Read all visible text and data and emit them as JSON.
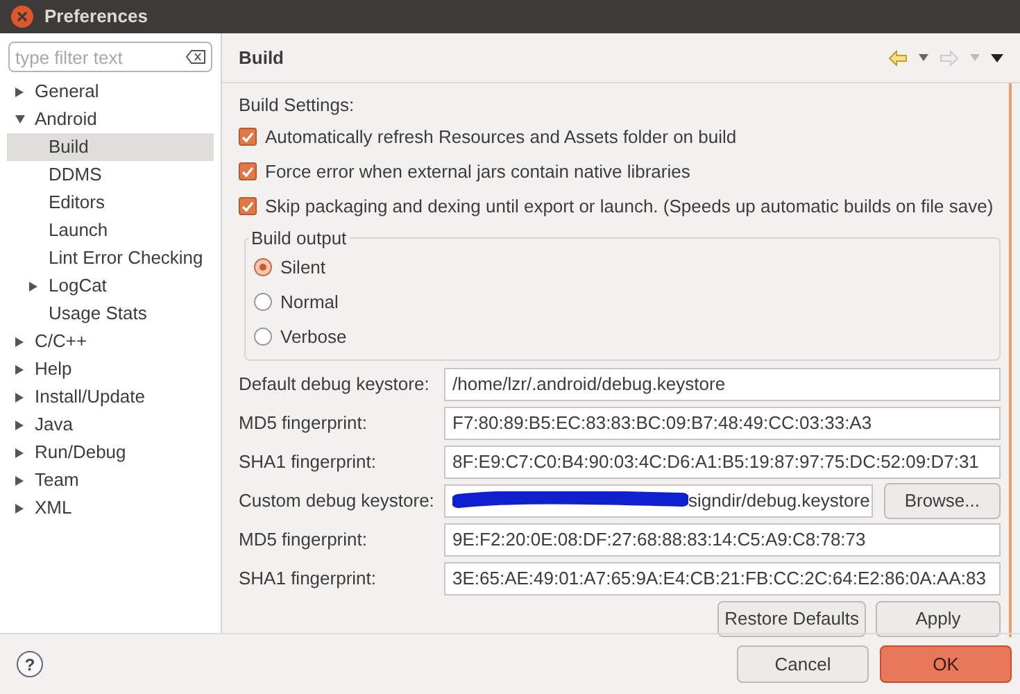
{
  "window": {
    "title": "Preferences"
  },
  "filter": {
    "placeholder": "type filter text"
  },
  "tree": [
    {
      "label": "General",
      "expanded": false,
      "selected": false
    },
    {
      "label": "Android",
      "expanded": true,
      "selected": false,
      "children": [
        {
          "label": "Build",
          "selected": true
        },
        {
          "label": "DDMS",
          "selected": false
        },
        {
          "label": "Editors",
          "selected": false
        },
        {
          "label": "Launch",
          "selected": false
        },
        {
          "label": "Lint Error Checking",
          "selected": false
        },
        {
          "label": "LogCat",
          "expanded": false,
          "selected": false
        },
        {
          "label": "Usage Stats",
          "selected": false
        }
      ]
    },
    {
      "label": "C/C++",
      "expanded": false,
      "selected": false
    },
    {
      "label": "Help",
      "expanded": false,
      "selected": false
    },
    {
      "label": "Install/Update",
      "expanded": false,
      "selected": false
    },
    {
      "label": "Java",
      "expanded": false,
      "selected": false
    },
    {
      "label": "Run/Debug",
      "expanded": false,
      "selected": false
    },
    {
      "label": "Team",
      "expanded": false,
      "selected": false
    },
    {
      "label": "XML",
      "expanded": false,
      "selected": false
    }
  ],
  "page": {
    "title": "Build",
    "settings_label": "Build Settings:",
    "checkboxes": [
      {
        "label": "Automatically refresh Resources and Assets folder on build",
        "checked": true
      },
      {
        "label": "Force error when external jars contain native libraries",
        "checked": true
      },
      {
        "label": "Skip packaging and dexing until export or launch. (Speeds up automatic builds on file save)",
        "checked": true
      }
    ],
    "build_output": {
      "title": "Build output",
      "options": [
        {
          "label": "Silent",
          "selected": true
        },
        {
          "label": "Normal",
          "selected": false
        },
        {
          "label": "Verbose",
          "selected": false
        }
      ]
    },
    "fields": [
      {
        "label": "Default debug keystore:",
        "value": "/home/lzr/.android/debug.keystore"
      },
      {
        "label": "MD5 fingerprint:",
        "value": "F7:80:89:B5:EC:83:83:BC:09:B7:48:49:CC:03:33:A3"
      },
      {
        "label": "SHA1 fingerprint:",
        "value": "8F:E9:C7:C0:B4:90:03:4C:D6:A1:B5:19:87:97:75:DC:52:09:D7:31"
      },
      {
        "label": "Custom debug keystore:",
        "value": "signdir/debug.keystore",
        "redacted": true,
        "button": "Browse..."
      },
      {
        "label": "MD5 fingerprint:",
        "value": "9E:F2:20:0E:08:DF:27:68:88:83:14:C5:A9:C8:78:73"
      },
      {
        "label": "SHA1 fingerprint:",
        "value": "3E:65:AE:49:01:A7:65:9A:E4:CB:21:FB:CC:2C:64:E2:86:0A:AA:83"
      }
    ],
    "buttons": [
      "Restore Defaults",
      "Apply"
    ]
  },
  "footer": {
    "help": "?",
    "buttons": [
      {
        "label": "Cancel",
        "primary": false
      },
      {
        "label": "OK",
        "primary": true
      }
    ]
  }
}
